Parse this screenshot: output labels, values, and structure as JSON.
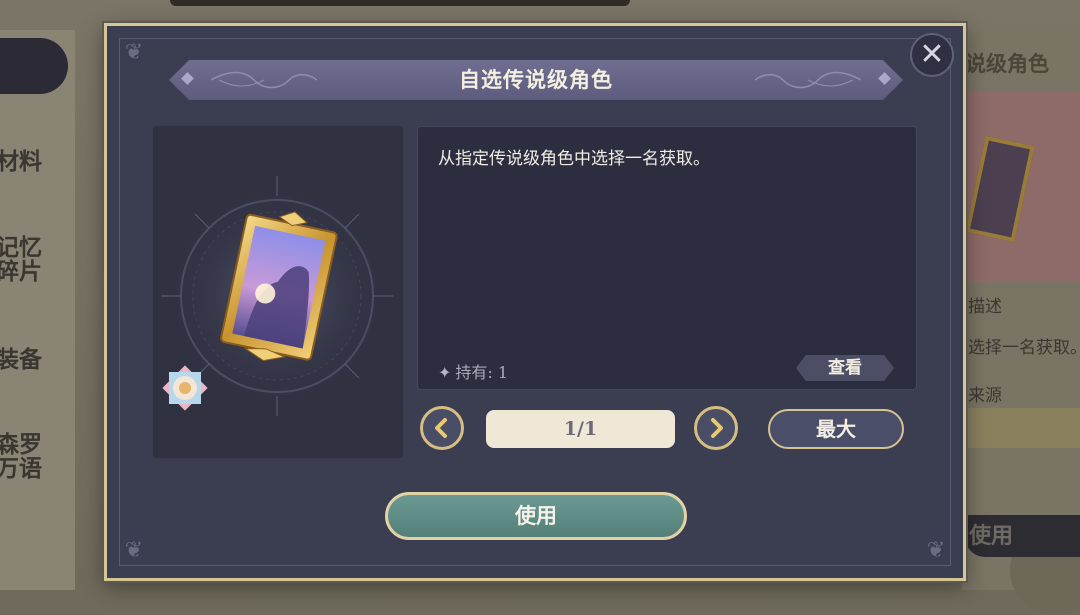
{
  "background": {
    "left_menu": [
      "材料",
      "记忆\n碎片",
      "装备",
      "森罗\n万语"
    ],
    "right_panel": {
      "title": "说级角色",
      "desc_header": "描述",
      "desc_snippet": "选择一名获取。",
      "source_header": "来源",
      "use_label": "使用"
    }
  },
  "dialog": {
    "title": "自选传说级角色",
    "close_icon": "close-icon",
    "item": {
      "icon": "golden-portrait-frame-icon",
      "badge_icon": "rarity-flower-badge-icon"
    },
    "description": "从指定传说级角色中选择一名获取。",
    "owned_label": "持有: 1",
    "view_button": "查看",
    "quantity": {
      "value": "1/1",
      "decrease_icon": "chevron-left-icon",
      "increase_icon": "chevron-right-icon"
    },
    "max_button": "最大",
    "use_button": "使用"
  },
  "colors": {
    "dialog_bg": "#3b3d51",
    "border_gold": "#d8c597",
    "title_banner": "#6a6a8c",
    "use_button": "#5f8d86"
  }
}
